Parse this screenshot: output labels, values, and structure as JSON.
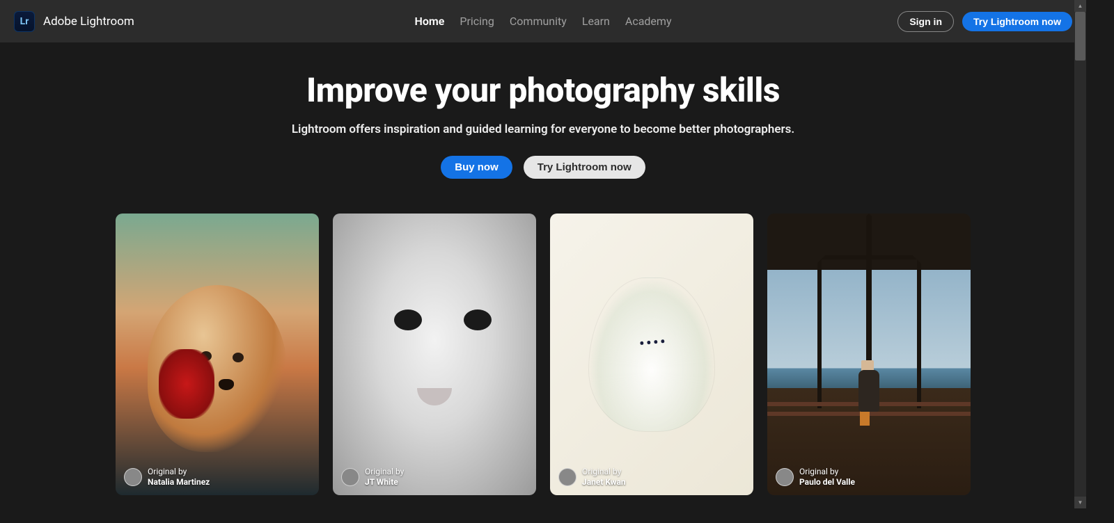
{
  "brand": {
    "logo_text": "Lr",
    "name": "Adobe Lightroom"
  },
  "nav": {
    "home": "Home",
    "pricing": "Pricing",
    "community": "Community",
    "learn": "Learn",
    "academy": "Academy"
  },
  "header_actions": {
    "sign_in": "Sign in",
    "try_now": "Try Lightroom now"
  },
  "hero": {
    "headline": "Improve your photography skills",
    "subhead": "Lightroom offers inspiration and guided learning for everyone to become better photographers.",
    "buy_now": "Buy now",
    "try_now": "Try Lightroom now"
  },
  "gallery": {
    "label": "Original by",
    "cards": [
      {
        "author": "Natalia Martinez"
      },
      {
        "author": "JT White"
      },
      {
        "author": "Janet Kwan"
      },
      {
        "author": "Paulo del Valle"
      }
    ]
  }
}
